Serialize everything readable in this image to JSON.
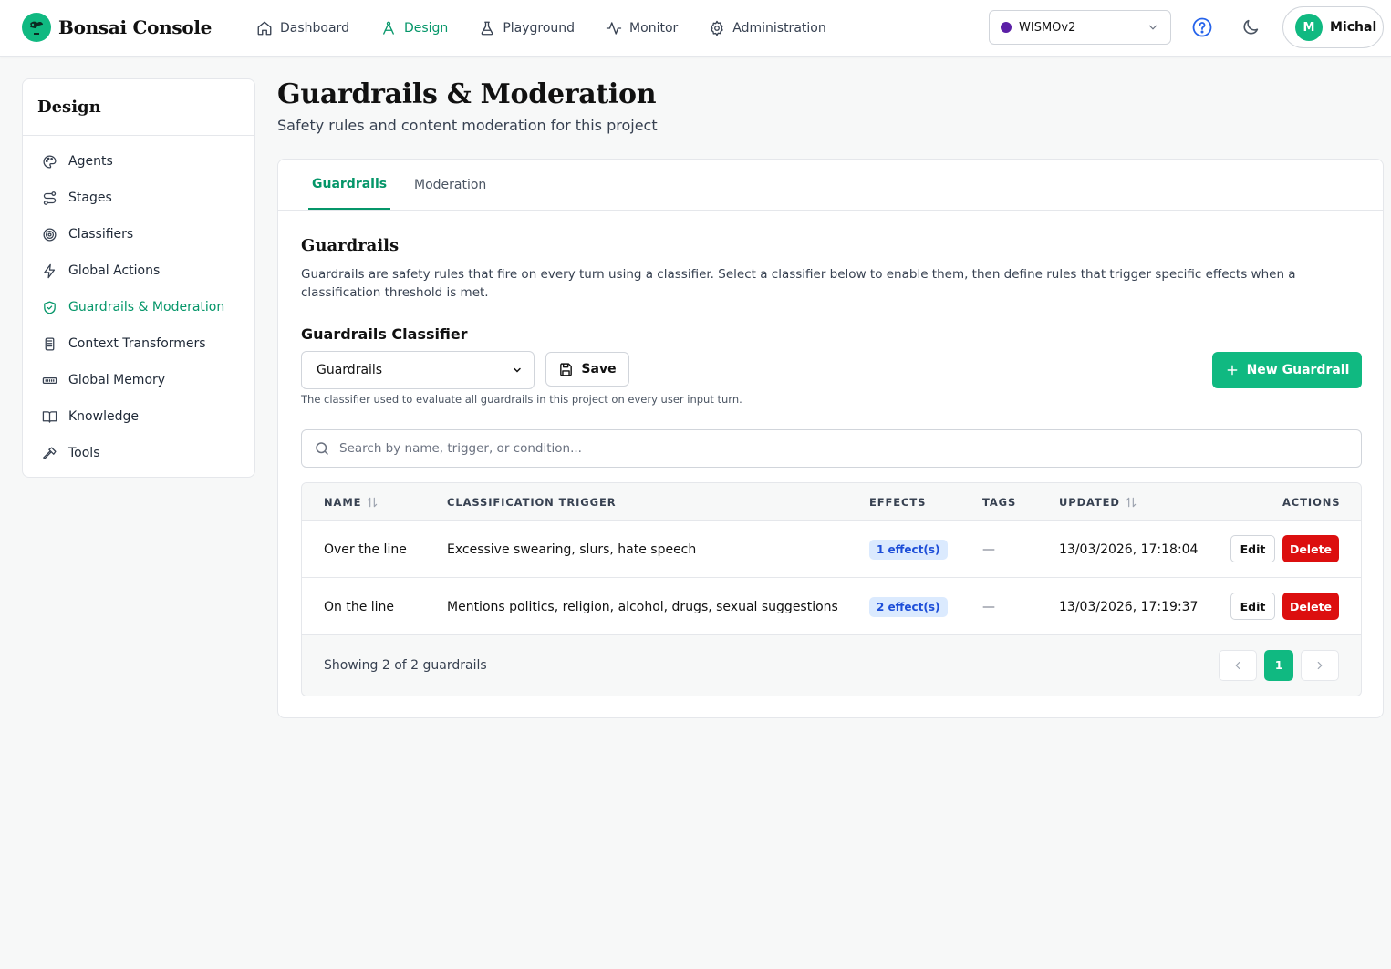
{
  "app": {
    "name": "Bonsai Console"
  },
  "nav": [
    {
      "label": "Dashboard",
      "icon": "home-icon",
      "active": false
    },
    {
      "label": "Design",
      "icon": "compass-icon",
      "active": true
    },
    {
      "label": "Playground",
      "icon": "flask-icon",
      "active": false
    },
    {
      "label": "Monitor",
      "icon": "activity-icon",
      "active": false
    },
    {
      "label": "Administration",
      "icon": "gear-icon",
      "active": false
    }
  ],
  "project": {
    "name": "WISMOv2",
    "dot_color": "#5b1fa6"
  },
  "user": {
    "initial": "M",
    "name": "Michal"
  },
  "sidebar": {
    "title": "Design",
    "items": [
      {
        "label": "Agents",
        "icon": "palette-icon"
      },
      {
        "label": "Stages",
        "icon": "route-icon"
      },
      {
        "label": "Classifiers",
        "icon": "target-icon"
      },
      {
        "label": "Global Actions",
        "icon": "zap-icon"
      },
      {
        "label": "Guardrails & Moderation",
        "icon": "shield-check-icon",
        "active": true
      },
      {
        "label": "Context Transformers",
        "icon": "scroll-icon"
      },
      {
        "label": "Global Memory",
        "icon": "memory-icon"
      },
      {
        "label": "Knowledge",
        "icon": "book-icon"
      },
      {
        "label": "Tools",
        "icon": "hammer-icon"
      }
    ]
  },
  "page": {
    "title": "Guardrails & Moderation",
    "subtitle": "Safety rules and content moderation for this project"
  },
  "tabs": [
    {
      "label": "Guardrails",
      "active": true
    },
    {
      "label": "Moderation",
      "active": false
    }
  ],
  "guardrails": {
    "title": "Guardrails",
    "description": "Guardrails are safety rules that fire on every turn using a classifier. Select a classifier below to enable them, then define rules that trigger specific effects when a classification threshold is met.",
    "classifier_label": "Guardrails Classifier",
    "classifier_value": "Guardrails",
    "save_label": "Save",
    "classifier_help": "The classifier used to evaluate all guardrails in this project on every user input turn.",
    "new_label": "New Guardrail",
    "search_placeholder": "Search by name, trigger, or condition...",
    "columns": {
      "name": "NAME",
      "trigger": "CLASSIFICATION TRIGGER",
      "effects": "EFFECTS",
      "tags": "TAGS",
      "updated": "UPDATED",
      "actions": "ACTIONS"
    },
    "rows": [
      {
        "name": "Over the line",
        "trigger": "Excessive swearing, slurs, hate speech",
        "effects": "1 effect(s)",
        "tags": "—",
        "updated": "13/03/2026, 17:18:04",
        "edit": "Edit",
        "delete": "Delete"
      },
      {
        "name": "On the line",
        "trigger": "Mentions politics, religion, alcohol, drugs, sexual suggestions",
        "effects": "2 effect(s)",
        "tags": "—",
        "updated": "13/03/2026, 17:19:37",
        "edit": "Edit",
        "delete": "Delete"
      }
    ],
    "showing": "Showing 2 of 2 guardrails",
    "current_page": "1"
  },
  "colors": {
    "accent": "#10b981",
    "accent_text": "#059669",
    "danger": "#dc0f0f",
    "badge_bg": "#dbeafe",
    "badge_text": "#1d4ed8"
  }
}
